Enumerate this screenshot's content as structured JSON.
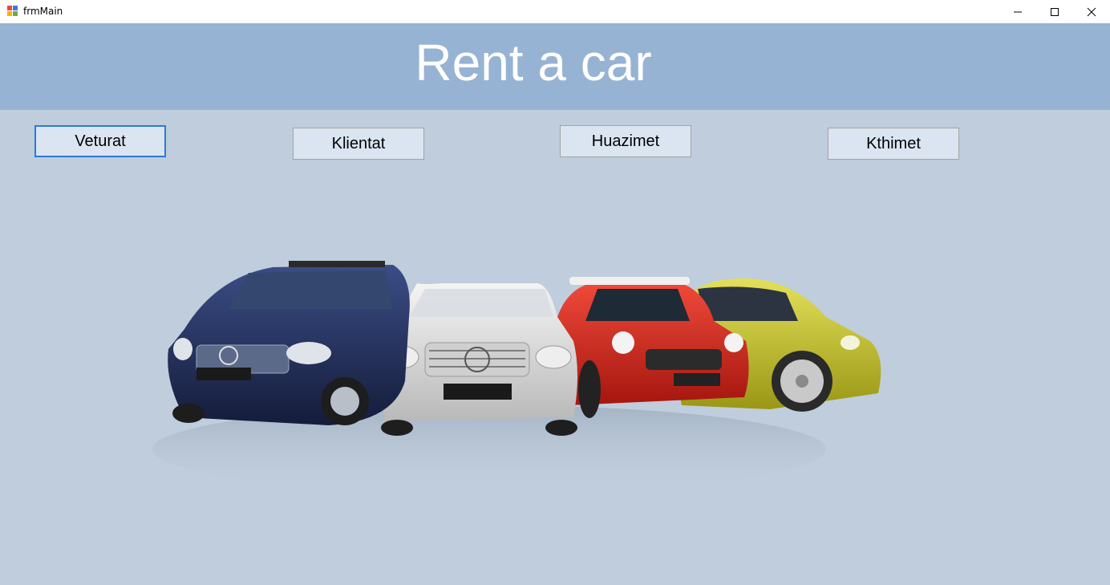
{
  "window": {
    "title": "frmMain",
    "app_icon": "winforms-app-icon",
    "controls": [
      "minimize-icon",
      "maximize-icon",
      "close-icon"
    ]
  },
  "header": {
    "title": "Rent a car",
    "background": "#97b3d3"
  },
  "nav": {
    "buttons": [
      {
        "label": "Veturat",
        "focused": true
      },
      {
        "label": "Klientat",
        "focused": false
      },
      {
        "label": "Huazimet",
        "focused": false
      },
      {
        "label": "Kthimet",
        "focused": false
      }
    ]
  },
  "colors": {
    "form_background": "#bfcddc",
    "button_background": "#dbe5f1",
    "focus_border": "#2b79d8",
    "car_colors": [
      "#1e2b55",
      "#d9d9d9",
      "#d6281e",
      "#c9c52a"
    ]
  }
}
